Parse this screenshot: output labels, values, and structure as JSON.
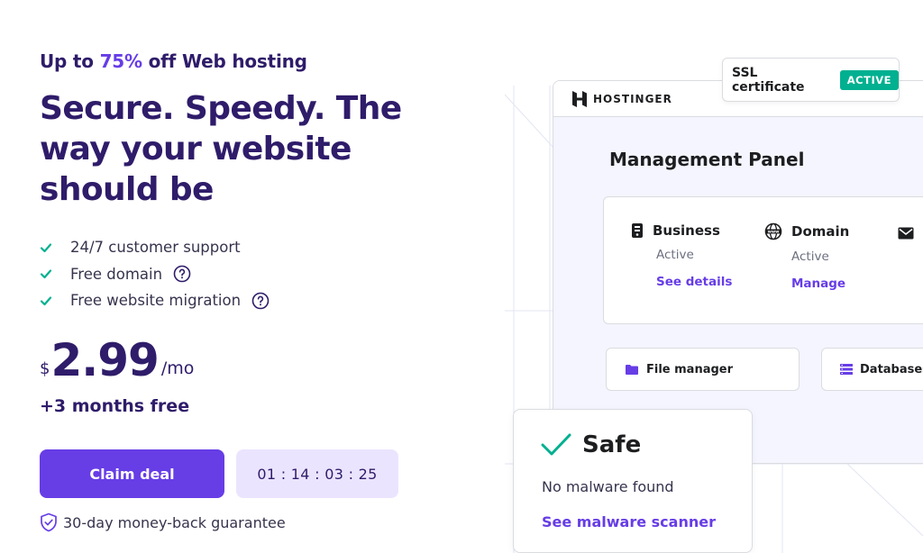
{
  "hero": {
    "promo_prefix": "Up to",
    "promo_percent": "75%",
    "promo_suffix": "off Web hosting",
    "headline": "Secure. Speedy. The way your website should be",
    "features": [
      {
        "label": "24/7 customer support",
        "has_help": false
      },
      {
        "label": "Free domain",
        "has_help": true
      },
      {
        "label": "Free website migration",
        "has_help": true
      }
    ],
    "price_currency": "$",
    "price_amount": "2.99",
    "price_period": "/mo",
    "bonus": "+3 months free",
    "claim_label": "Claim deal",
    "countdown": "01 : 14 : 03 : 25",
    "guarantee": "30-day money-back guarantee"
  },
  "illustration": {
    "brand": "HOSTINGER",
    "ssl_label": "SSL certificate",
    "ssl_status": "ACTIVE",
    "panel_title": "Management Panel",
    "services": [
      {
        "name": "Business",
        "status": "Active",
        "link": "See details",
        "icon": "server-icon"
      },
      {
        "name": "Domain",
        "status": "Active",
        "link": "Manage",
        "icon": "www-globe-icon"
      }
    ],
    "tiles": [
      {
        "label": "File manager",
        "icon": "folder-icon"
      },
      {
        "label": "Databases",
        "icon": "database-icon"
      }
    ],
    "safe_title": "Safe",
    "safe_message": "No malware found",
    "safe_link": "See malware scanner"
  },
  "colors": {
    "primary": "#673de6",
    "heading": "#2f1c6a",
    "check": "#00b090",
    "timer_bg": "#ebe4ff"
  }
}
